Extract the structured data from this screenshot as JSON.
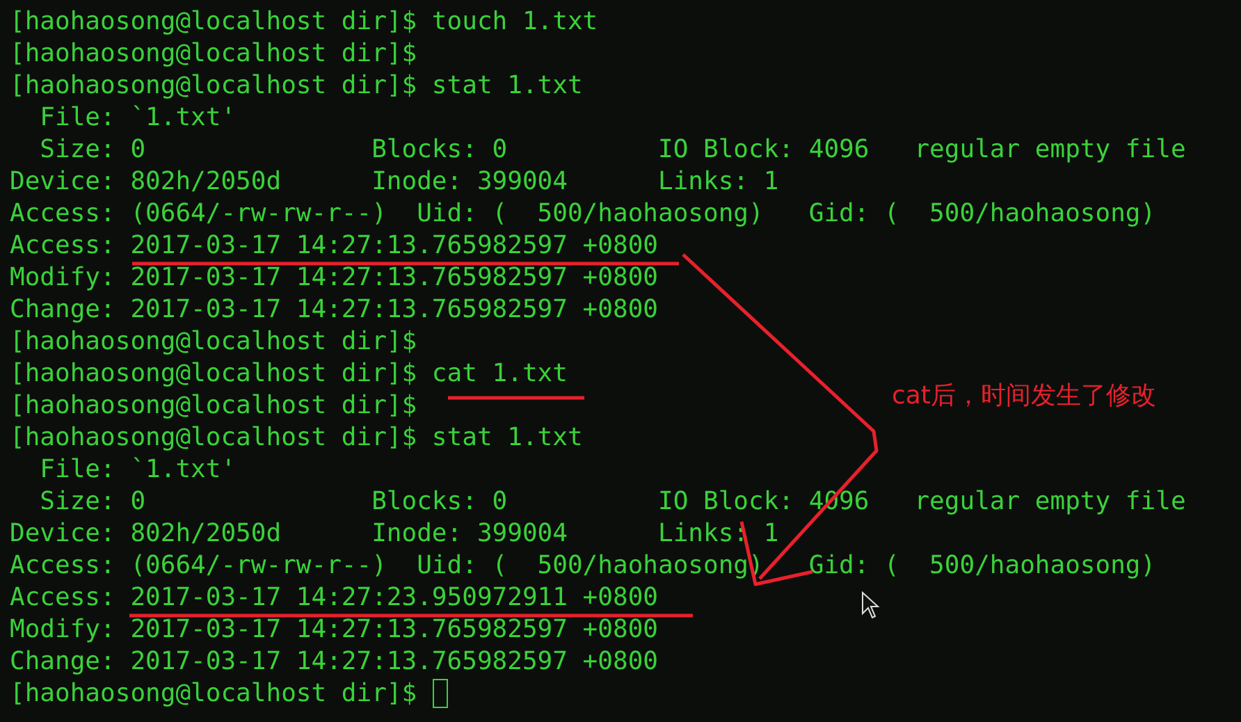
{
  "terminal": {
    "lines": [
      "[haohaosong@localhost dir]$ touch 1.txt",
      "[haohaosong@localhost dir]$",
      "[haohaosong@localhost dir]$ stat 1.txt",
      "  File: `1.txt'",
      "  Size: 0               Blocks: 0          IO Block: 4096   regular empty file",
      "Device: 802h/2050d      Inode: 399004      Links: 1",
      "Access: (0664/-rw-rw-r--)  Uid: (  500/haohaosong)   Gid: (  500/haohaosong)",
      "Access: 2017-03-17 14:27:13.765982597 +0800",
      "Modify: 2017-03-17 14:27:13.765982597 +0800",
      "Change: 2017-03-17 14:27:13.765982597 +0800",
      "[haohaosong@localhost dir]$",
      "[haohaosong@localhost dir]$ cat 1.txt",
      "[haohaosong@localhost dir]$",
      "[haohaosong@localhost dir]$ stat 1.txt",
      "  File: `1.txt'",
      "  Size: 0               Blocks: 0          IO Block: 4096   regular empty file",
      "Device: 802h/2050d      Inode: 399004      Links: 1",
      "Access: (0664/-rw-rw-r--)  Uid: (  500/haohaosong)   Gid: (  500/haohaosong)",
      "Access: 2017-03-17 14:27:23.950972911 +0800",
      "Modify: 2017-03-17 14:27:13.765982597 +0800",
      "Change: 2017-03-17 14:27:13.765982597 +0800",
      "[haohaosong@localhost dir]$"
    ],
    "cursor": true
  },
  "annotation": {
    "text": "cat后，时间发生了修改"
  }
}
